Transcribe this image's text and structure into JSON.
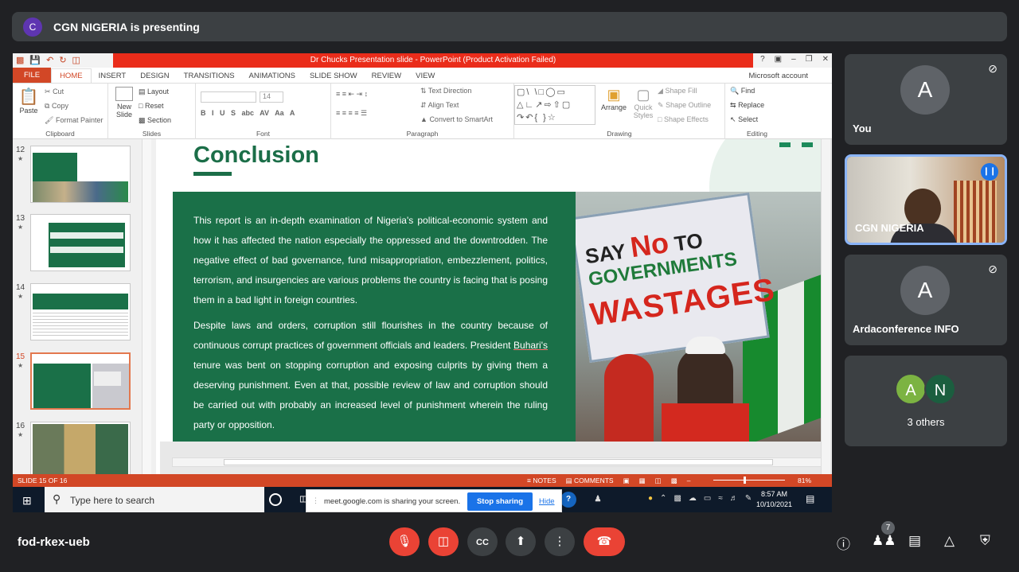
{
  "meet": {
    "presenter_initial": "C",
    "presenter_text": "CGN NIGERIA is presenting",
    "meeting_code": "fod-rkex-ueb",
    "participant_count": "7",
    "accent": "#1a73e8",
    "hangup_color": "#ea4335",
    "participants": [
      {
        "initial": "A",
        "name": "You",
        "muted": true
      },
      {
        "name": "CGN NIGERIA",
        "speaking": true
      },
      {
        "initial": "A",
        "name": "Ardaconference INFO",
        "muted": true
      }
    ],
    "others": {
      "initials": [
        "A",
        "N"
      ],
      "label": "3 others"
    },
    "controls": [
      "mic-off-icon",
      "camera-off-icon",
      "captions-icon",
      "present-icon",
      "more-icon",
      "hangup-icon"
    ],
    "right_controls": [
      "info-icon",
      "people-icon",
      "chat-icon",
      "activities-icon",
      "safety-icon"
    ]
  },
  "ppt": {
    "window_title": "Dr Chucks Presentation slide - PowerPoint (Product Activation Failed)",
    "tabs": [
      "FILE",
      "HOME",
      "INSERT",
      "DESIGN",
      "TRANSITIONS",
      "ANIMATIONS",
      "SLIDE SHOW",
      "REVIEW",
      "VIEW"
    ],
    "account": "Microsoft account",
    "ribbon": {
      "paste": "Paste",
      "cut": "Cut",
      "copy": "Copy",
      "format_painter": "Format Painter",
      "clipboard": "Clipboard",
      "new_slide": "New Slide",
      "layout": "Layout",
      "reset": "Reset",
      "section": "Section",
      "slides": "Slides",
      "font_size": "14",
      "font": "Font",
      "text_direction": "Text Direction",
      "align_text": "Align Text",
      "convert_smartart": "Convert to SmartArt",
      "paragraph": "Paragraph",
      "arrange": "Arrange",
      "quick_styles": "Quick Styles",
      "shape_fill": "Shape Fill",
      "shape_outline": "Shape Outline",
      "shape_effects": "Shape Effects",
      "drawing": "Drawing",
      "find": "Find",
      "replace": "Replace",
      "select": "Select",
      "editing": "Editing"
    },
    "thumbnails": [
      {
        "num": "12"
      },
      {
        "num": "13"
      },
      {
        "num": "14"
      },
      {
        "num": "15",
        "selected": true
      },
      {
        "num": "16"
      }
    ],
    "slide": {
      "title": "Conclusion",
      "paragraph1": "This report is an in-depth examination of Nigeria's political-economic system and how it has affected the nation especially the oppressed and the downtrodden. The negative effect of bad governance, fund misappropriation, embezzlement, politics, terrorism, and insurgencies are various problems the country is facing that is posing them in a bad light in foreign countries.",
      "paragraph2_a": "Despite laws and orders, corruption still flourishes in the country because of continuous corrupt practices of government officials and leaders. President ",
      "paragraph2_link": "Buhari's",
      "paragraph2_b": " tenure was bent on stopping corruption and exposing culprits by giving them a deserving punishment. Even at that, possible review of law and corruption should be carried out with probably an increased level of punishment wherein the ruling party or opposition.",
      "sign_line1a": "SAY ",
      "sign_line1b": "No",
      "sign_line1c": " TO",
      "sign_line2": "GOVERNMENTS",
      "sign_line3": "WASTAGES",
      "green": "#1a7048"
    },
    "share_bar": {
      "message": "meet.google.com is sharing your screen.",
      "stop": "Stop sharing",
      "hide": "Hide"
    },
    "status": {
      "slide_of": "SLIDE 15 OF 16",
      "notes": "NOTES",
      "comments": "COMMENTS",
      "zoom": "81%"
    },
    "taskbar": {
      "search_placeholder": "Type here to search",
      "time": "8:57 AM",
      "date": "10/10/2021"
    }
  }
}
